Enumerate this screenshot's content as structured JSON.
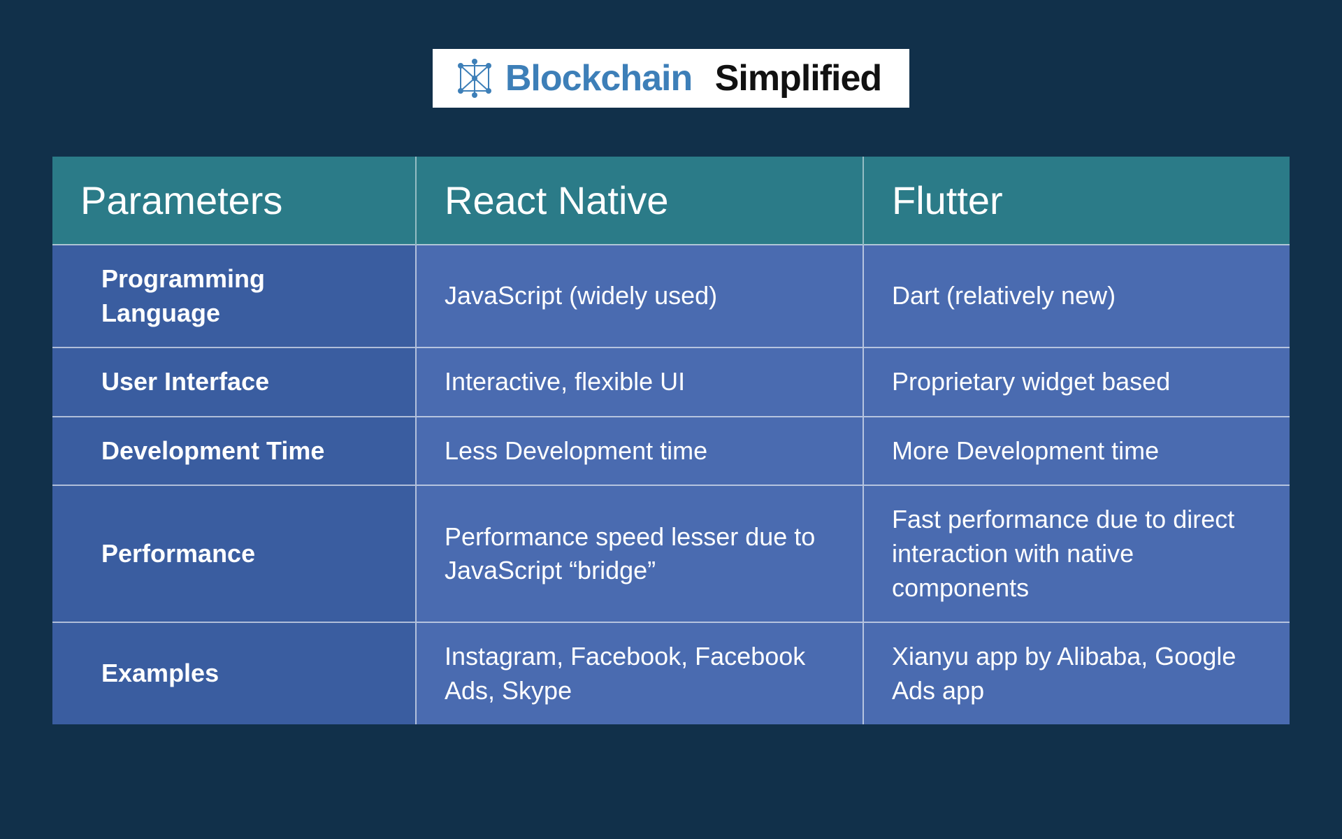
{
  "logo": {
    "word1": "Blockchain",
    "word2": "Simplified"
  },
  "headers": {
    "col1": "Parameters",
    "col2": "React Native",
    "col3": "Flutter"
  },
  "rows": [
    {
      "param": "Programming Language",
      "react": "JavaScript (widely used)",
      "flutter": "Dart (relatively new)"
    },
    {
      "param": "User Interface",
      "react": "Interactive, flexible UI",
      "flutter": "Proprietary widget based"
    },
    {
      "param": "Development Time",
      "react": "Less Development time",
      "flutter": "More Development time"
    },
    {
      "param": "Performance",
      "react": "Performance speed lesser due to JavaScript “bridge”",
      "flutter": "Fast performance due to direct interaction with native components"
    },
    {
      "param": "Examples",
      "react": "Instagram, Facebook, Facebook Ads, Skype",
      "flutter": "Xianyu app by Alibaba, Google Ads app"
    }
  ]
}
